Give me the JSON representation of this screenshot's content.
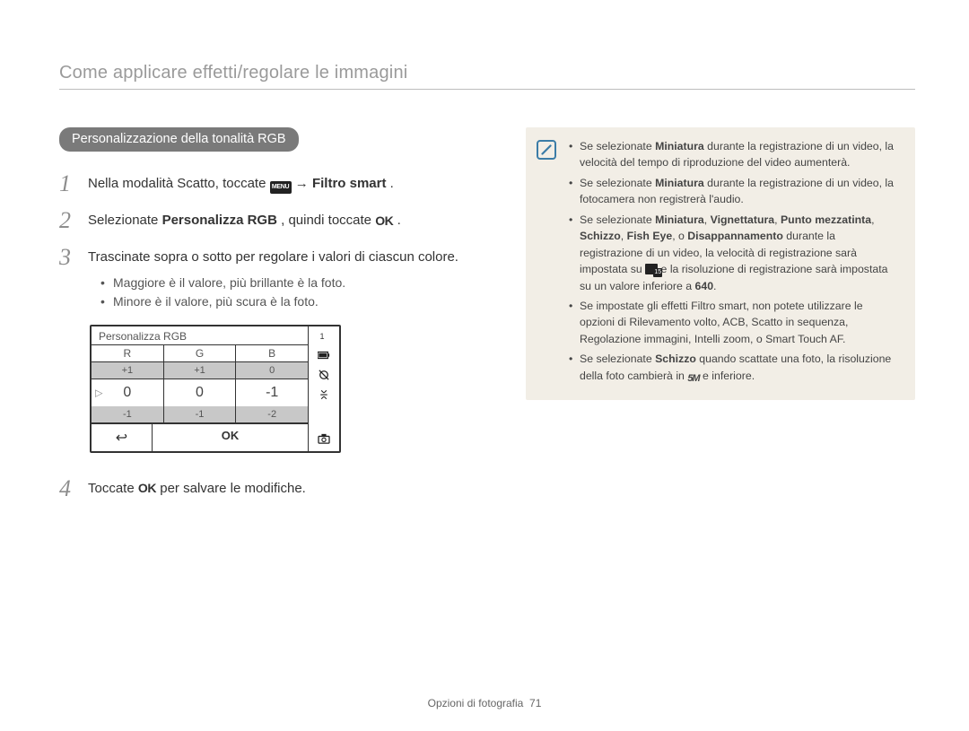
{
  "header": "Come applicare effetti/regolare le immagini",
  "section_pill": "Personalizzazione della tonalità RGB",
  "steps": {
    "one": {
      "pre": "Nella modalità Scatto, toccate ",
      "menu_label": "MENU",
      "arrow": " → ",
      "bold": "Filtro smart",
      "post": "."
    },
    "two": {
      "pre": "Selezionate ",
      "bold": "Personalizza RGB",
      "mid": ", quindi toccate ",
      "ok": "OK",
      "post": " ."
    },
    "three": {
      "text": "Trascinate sopra o sotto per regolare i valori di ciascun colore.",
      "bullets": [
        "Maggiore è il valore, più brillante è la foto.",
        "Minore è il valore, più scura è la foto."
      ]
    },
    "four": {
      "pre": "Toccate ",
      "ok": "OK",
      "post": " per salvare le modifiche."
    }
  },
  "device": {
    "title": "Personalizza RGB",
    "headers": [
      "R",
      "G",
      "B"
    ],
    "row_top": [
      "+1",
      "+1",
      "0"
    ],
    "row_mid": [
      "0",
      "0",
      "-1"
    ],
    "row_bot": [
      "-1",
      "-1",
      "-2"
    ],
    "back": "↩",
    "ok": "OK",
    "side_counter": "1"
  },
  "notes": [
    {
      "parts": [
        {
          "t": "Se selezionate "
        },
        {
          "b": "Miniatura"
        },
        {
          "t": " durante la registrazione di un video, la velocità del tempo di riproduzione del video aumenterà."
        }
      ]
    },
    {
      "parts": [
        {
          "t": "Se selezionate "
        },
        {
          "b": "Miniatura"
        },
        {
          "t": " durante la registrazione di un video, la fotocamera non registrerà l'audio."
        }
      ]
    },
    {
      "parts": [
        {
          "t": "Se selezionate "
        },
        {
          "b": "Miniatura"
        },
        {
          "t": ", "
        },
        {
          "b": "Vignettatura"
        },
        {
          "t": ", "
        },
        {
          "b": "Punto mezzatinta"
        },
        {
          "t": ", "
        },
        {
          "b": "Schizzo"
        },
        {
          "t": ", "
        },
        {
          "b": "Fish Eye"
        },
        {
          "t": ", o "
        },
        {
          "b": "Disappannamento"
        },
        {
          "t": " durante la registrazione di un video, la velocità di registrazione sarà impostata su "
        },
        {
          "ico": "fps"
        },
        {
          "t": " e la risoluzione di registrazione sarà impostata su un valore inferiore a "
        },
        {
          "b": "640"
        },
        {
          "t": "."
        }
      ]
    },
    {
      "parts": [
        {
          "t": "Se impostate gli effetti Filtro smart, non potete utilizzare le opzioni di Rilevamento volto, ACB, Scatto in sequenza, Regolazione immagini, Intelli zoom, o Smart Touch AF."
        }
      ]
    },
    {
      "parts": [
        {
          "t": "Se selezionate "
        },
        {
          "b": "Schizzo"
        },
        {
          "t": " quando scattate una foto, la risoluzione della foto cambierà in "
        },
        {
          "ico": "mp",
          "label": "5M"
        },
        {
          "t": " e inferiore."
        }
      ]
    }
  ],
  "footer": {
    "section": "Opzioni di fotografia",
    "page": "71"
  }
}
